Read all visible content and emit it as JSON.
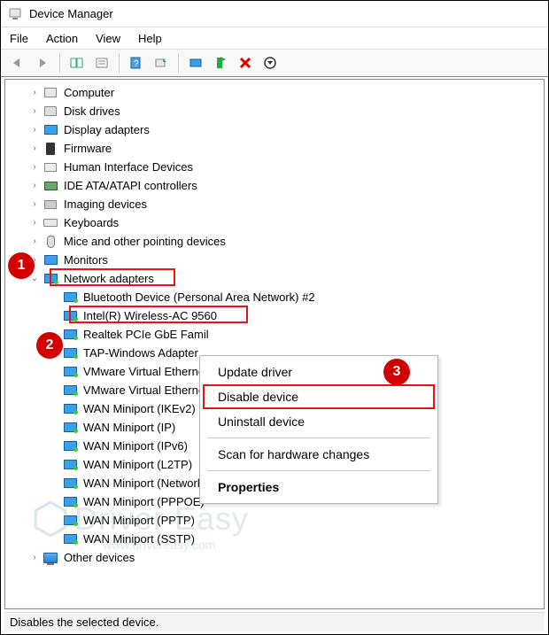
{
  "title": "Device Manager",
  "menu": {
    "file": "File",
    "action": "Action",
    "view": "View",
    "help": "Help"
  },
  "tree": {
    "items": [
      {
        "label": "Computer",
        "icon": "pc",
        "expanded": false
      },
      {
        "label": "Disk drives",
        "icon": "disk",
        "expanded": false
      },
      {
        "label": "Display adapters",
        "icon": "mon",
        "expanded": false
      },
      {
        "label": "Firmware",
        "icon": "fw",
        "expanded": false
      },
      {
        "label": "Human Interface Devices",
        "icon": "hid",
        "expanded": false
      },
      {
        "label": "IDE ATA/ATAPI controllers",
        "icon": "ide",
        "expanded": false
      },
      {
        "label": "Imaging devices",
        "icon": "img",
        "expanded": false
      },
      {
        "label": "Keyboards",
        "icon": "kb",
        "expanded": false
      },
      {
        "label": "Mice and other pointing devices",
        "icon": "mouse",
        "expanded": false
      },
      {
        "label": "Monitors",
        "icon": "mon",
        "expanded": false
      },
      {
        "label": "Network adapters",
        "icon": "net",
        "expanded": true,
        "children": [
          {
            "label": "Bluetooth Device (Personal Area Network) #2"
          },
          {
            "label": "Intel(R) Wireless-AC 9560",
            "highlight": true
          },
          {
            "label": "Realtek PCIe GbE Famil"
          },
          {
            "label": "TAP-Windows Adapter "
          },
          {
            "label": "VMware Virtual Etherne"
          },
          {
            "label": "VMware Virtual Etherne"
          },
          {
            "label": "WAN Miniport (IKEv2)"
          },
          {
            "label": "WAN Miniport (IP)"
          },
          {
            "label": "WAN Miniport (IPv6)"
          },
          {
            "label": "WAN Miniport (L2TP)"
          },
          {
            "label": "WAN Miniport (Network Monitor)"
          },
          {
            "label": "WAN Miniport (PPPOE)"
          },
          {
            "label": "WAN Miniport (PPTP)"
          },
          {
            "label": "WAN Miniport (SSTP)"
          }
        ]
      },
      {
        "label": "Other devices",
        "icon": "dev",
        "expanded": false
      }
    ]
  },
  "context_menu": {
    "items": [
      {
        "label": "Update driver"
      },
      {
        "label": "Disable device",
        "highlight": true
      },
      {
        "label": "Uninstall device"
      },
      {
        "sep": true
      },
      {
        "label": "Scan for hardware changes"
      },
      {
        "sep": true
      },
      {
        "label": "Properties",
        "bold": true
      }
    ]
  },
  "statusbar": "Disables the selected device.",
  "annotations": {
    "1": "1",
    "2": "2",
    "3": "3"
  },
  "watermark": {
    "brand": "Driver Easy",
    "sub": "www.drivereasy.com"
  }
}
